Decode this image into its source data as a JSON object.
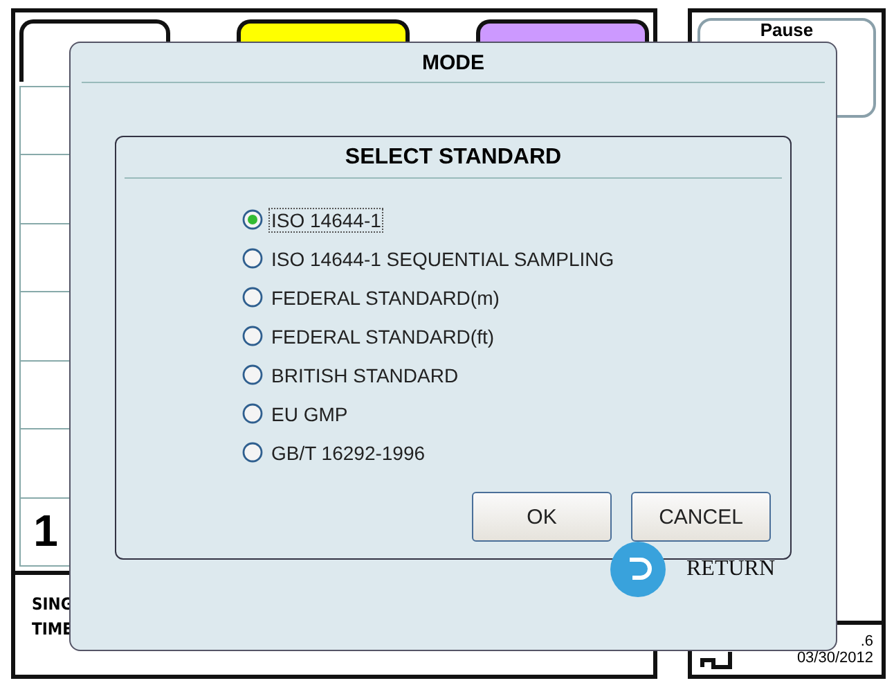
{
  "background": {
    "tabs": [
      {
        "color": "#ffffff"
      },
      {
        "color": "#ffff00"
      },
      {
        "color": "#cc99ff"
      }
    ],
    "pause_button": "Pause",
    "count": "1",
    "info_lines": [
      "SING",
      "TIME"
    ],
    "footer": {
      "value": ".6",
      "date": "03/30/2012"
    }
  },
  "dialog": {
    "title": "MODE",
    "return_label": "RETURN",
    "sub_dialog": {
      "title": "SELECT STANDARD",
      "options": [
        {
          "label": "ISO 14644-1",
          "selected": true
        },
        {
          "label": "ISO 14644-1 SEQUENTIAL SAMPLING",
          "selected": false
        },
        {
          "label": "FEDERAL STANDARD(m)",
          "selected": false
        },
        {
          "label": "FEDERAL STANDARD(ft)",
          "selected": false
        },
        {
          "label": "BRITISH STANDARD",
          "selected": false
        },
        {
          "label": "EU GMP",
          "selected": false
        },
        {
          "label": "GB/T 16292-1996",
          "selected": false
        }
      ],
      "buttons": [
        "OK",
        "CANCEL"
      ]
    }
  }
}
